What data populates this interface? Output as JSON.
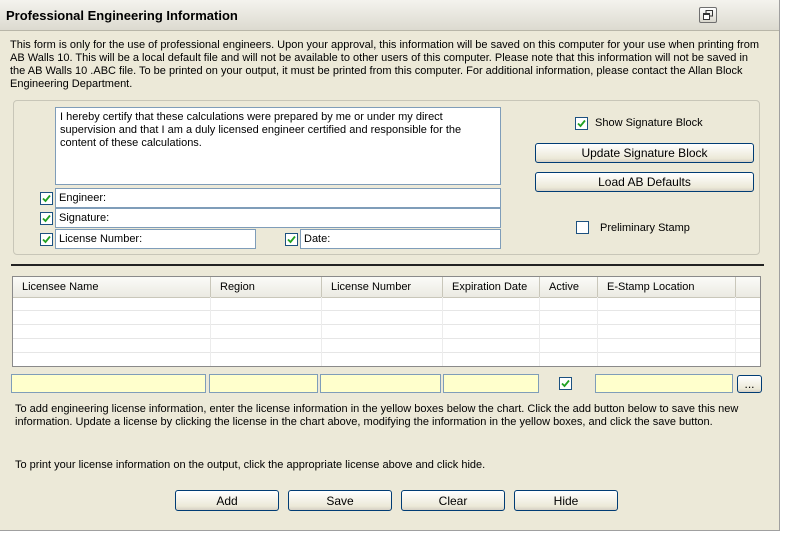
{
  "window": {
    "title": "Professional Engineering Information"
  },
  "intro": "This form is only for the use of professional engineers. Upon your approval, this information will be saved on this computer for your use when printing from AB Walls 10.  This will be a local default file and will not be available to other users of this computer.  Please note that this information will not be saved in the AB Walls 10 .ABC file.  To be printed on your output, it must be printed from this computer. For additional information, please contact the Allan Block Engineering Department.",
  "certification": "I hereby certify that these calculations were prepared by me or under my direct supervision and that I am a duly licensed engineer certified and responsible for the content of these calculations.",
  "fields": {
    "engineer": "Engineer:",
    "signature": "Signature:",
    "license_number": "License Number:",
    "date": "Date:"
  },
  "options": {
    "show_signature_block": "Show Signature Block",
    "preliminary_stamp": "Preliminary Stamp"
  },
  "buttons": {
    "update_signature": "Update Signature Block",
    "load_defaults": "Load AB Defaults",
    "browse": "...",
    "add": "Add",
    "save": "Save",
    "clear": "Clear",
    "hide": "Hide"
  },
  "table": {
    "columns": [
      "Licensee Name",
      "Region",
      "License Number",
      "Expiration Date",
      "Active",
      "E-Stamp Location"
    ],
    "rows": []
  },
  "help": {
    "add_info": "To add engineering license information, enter the license information in the yellow boxes below the chart.  Click the add button below to save this new information.  Update a license by clicking the license in the chart above, modifying the information in the yellow boxes, and click the save button.",
    "print_info": "To print your license information on the output, click the appropriate license above and click hide."
  },
  "colors": {
    "window_bg": "#ece9d8",
    "input_yellow": "#ffffcc",
    "checkmark": "#21a121"
  }
}
